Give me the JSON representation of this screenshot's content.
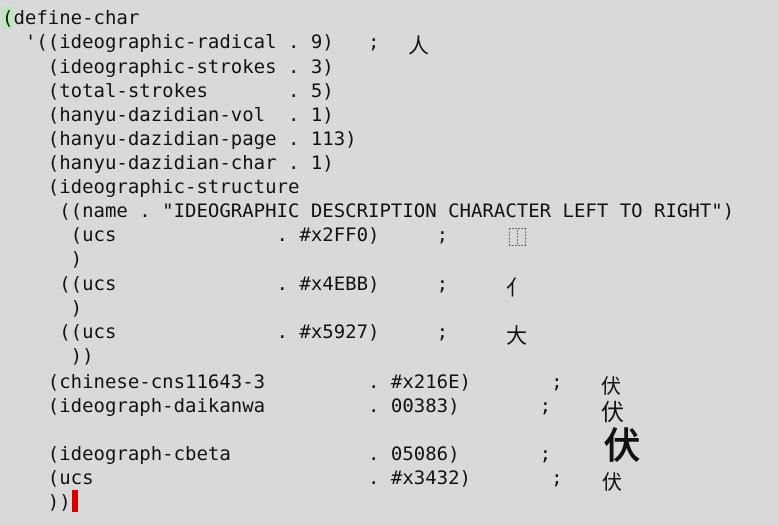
{
  "buffer": {
    "lines": [
      "(define-char",
      "  '((ideographic-radical . 9)   ; ",
      "    (ideographic-strokes . 3)",
      "    (total-strokes       . 5)",
      "    (hanyu-dazidian-vol  . 1)",
      "    (hanyu-dazidian-page . 113)",
      "    (hanyu-dazidian-char . 1)",
      "    (ideographic-structure",
      "     ((name . \"IDEOGRAPHIC DESCRIPTION CHARACTER LEFT TO RIGHT\")",
      "      (ucs              . #x2FF0)     ; ",
      "      )",
      "     ((ucs              . #x4EBB)     ; ",
      "      )",
      "     ((ucs              . #x5927)     ; ",
      "      ))",
      "    (chinese-cns11643-3         . #x216E)       ; ",
      "    (ideograph-daikanwa         . 00383)       ; ",
      "",
      "    (ideograph-cbeta            . 05086)       ; ",
      "    (ucs                        . #x3432)       ; ",
      "    ))"
    ],
    "first_char": "(",
    "first_rest": "define-char"
  },
  "glyphs": {
    "radical": "人",
    "ucs_2ff0": "⿰",
    "ucs_4ebb": "亻",
    "ucs_5927": "大",
    "cns": "伏",
    "daikanwa": "伏",
    "cbeta": "伏",
    "ucs_3432": "伏"
  },
  "colors": {
    "background": "#d9d9d9",
    "paren_highlight": "#b9e8b9",
    "cursor": "#d40000"
  }
}
